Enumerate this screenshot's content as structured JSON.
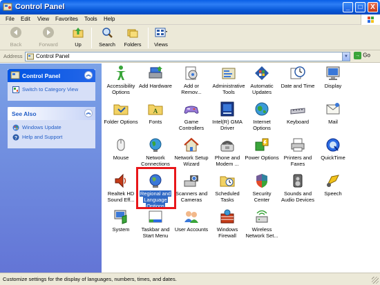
{
  "window": {
    "title": "Control Panel",
    "buttons": {
      "minimize": "_",
      "maximize": "□",
      "close": "X"
    }
  },
  "menu": {
    "items": [
      "File",
      "Edit",
      "View",
      "Favorites",
      "Tools",
      "Help"
    ]
  },
  "toolbar": {
    "back": "Back",
    "forward": "Forward",
    "up": "Up",
    "search": "Search",
    "folders": "Folders",
    "views": "Views"
  },
  "address": {
    "label": "Address",
    "value": "Control Panel",
    "go": "Go"
  },
  "left_panel": {
    "control_panel": {
      "title": "Control Panel",
      "links": [
        "Switch to Category View"
      ]
    },
    "see_also": {
      "title": "See Also",
      "links": [
        "Windows Update",
        "Help and Support"
      ]
    }
  },
  "items": [
    [
      "Accessibility",
      "Options"
    ],
    [
      "Add Hardware",
      ""
    ],
    [
      "Add or",
      "Remov..."
    ],
    [
      "Administrative",
      "Tools"
    ],
    [
      "Automatic",
      "Updates"
    ],
    [
      "Date and Time",
      ""
    ],
    [
      "Display",
      ""
    ],
    [
      "Folder Options",
      ""
    ],
    [
      "Fonts",
      ""
    ],
    [
      "Game",
      "Controllers"
    ],
    [
      "Intel(R) GMA",
      "Driver"
    ],
    [
      "Internet",
      "Options"
    ],
    [
      "Keyboard",
      ""
    ],
    [
      "Mail",
      ""
    ],
    [
      "Mouse",
      ""
    ],
    [
      "Network",
      "Connections"
    ],
    [
      "Network Setup",
      "Wizard"
    ],
    [
      "Phone and",
      "Modem ..."
    ],
    [
      "Power Options",
      ""
    ],
    [
      "Printers and",
      "Faxes"
    ],
    [
      "QuickTime",
      ""
    ],
    [
      "Realtek HD",
      "Sound Eff..."
    ],
    [
      "Regional and",
      "Language",
      "Options"
    ],
    [
      "Scanners and",
      "Cameras"
    ],
    [
      "Scheduled",
      "Tasks"
    ],
    [
      "Security",
      "Center"
    ],
    [
      "Sounds and",
      "Audio Devices"
    ],
    [
      "Speech",
      ""
    ],
    [
      "System",
      ""
    ],
    [
      "Taskbar and",
      "Start Menu"
    ],
    [
      "User Accounts",
      ""
    ],
    [
      "Windows",
      "Firewall"
    ],
    [
      "Wireless",
      "Network Set..."
    ]
  ],
  "status": {
    "text": "Customize settings for the display of languages, numbers, times, and dates."
  },
  "colors": {
    "titlebar": "#0858d8",
    "selection": "#316ac5",
    "highlight_frame": "#e8161a",
    "left_panel": "#6f8fe0"
  }
}
